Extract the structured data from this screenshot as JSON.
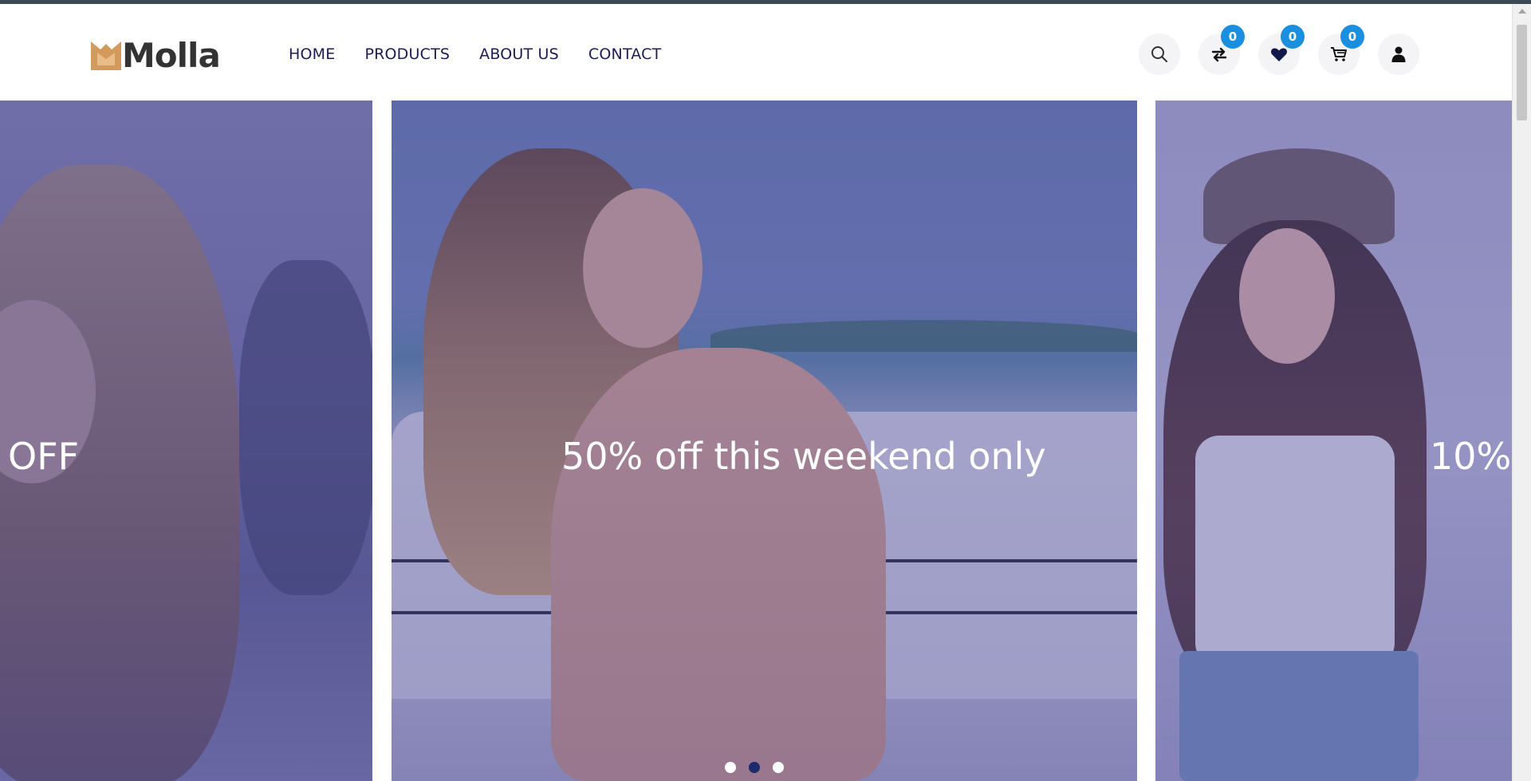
{
  "brand": {
    "name": "Molla",
    "mark_color": "#d49a5c",
    "text_color": "#333333"
  },
  "nav": {
    "items": [
      {
        "label": "HOME"
      },
      {
        "label": "PRODUCTS"
      },
      {
        "label": "ABOUT US"
      },
      {
        "label": "CONTACT"
      }
    ]
  },
  "header_icons": [
    {
      "icon": "search-icon",
      "badge": null
    },
    {
      "icon": "compare-arrows-icon",
      "badge": "0"
    },
    {
      "icon": "heart-icon",
      "badge": "0"
    },
    {
      "icon": "cart-icon",
      "badge": "0"
    },
    {
      "icon": "user-icon",
      "badge": null
    }
  ],
  "carousel": {
    "slides": [
      {
        "text": "OFF"
      },
      {
        "text": "50% off this weekend only"
      },
      {
        "text": "10%"
      }
    ],
    "dots": 3,
    "active_dot": 2,
    "overlay_color": "#3c3c8c"
  },
  "colors": {
    "accent": "#1a8fe0",
    "nav_text": "#1c1c5a",
    "active_dot": "#1c2a6e"
  }
}
